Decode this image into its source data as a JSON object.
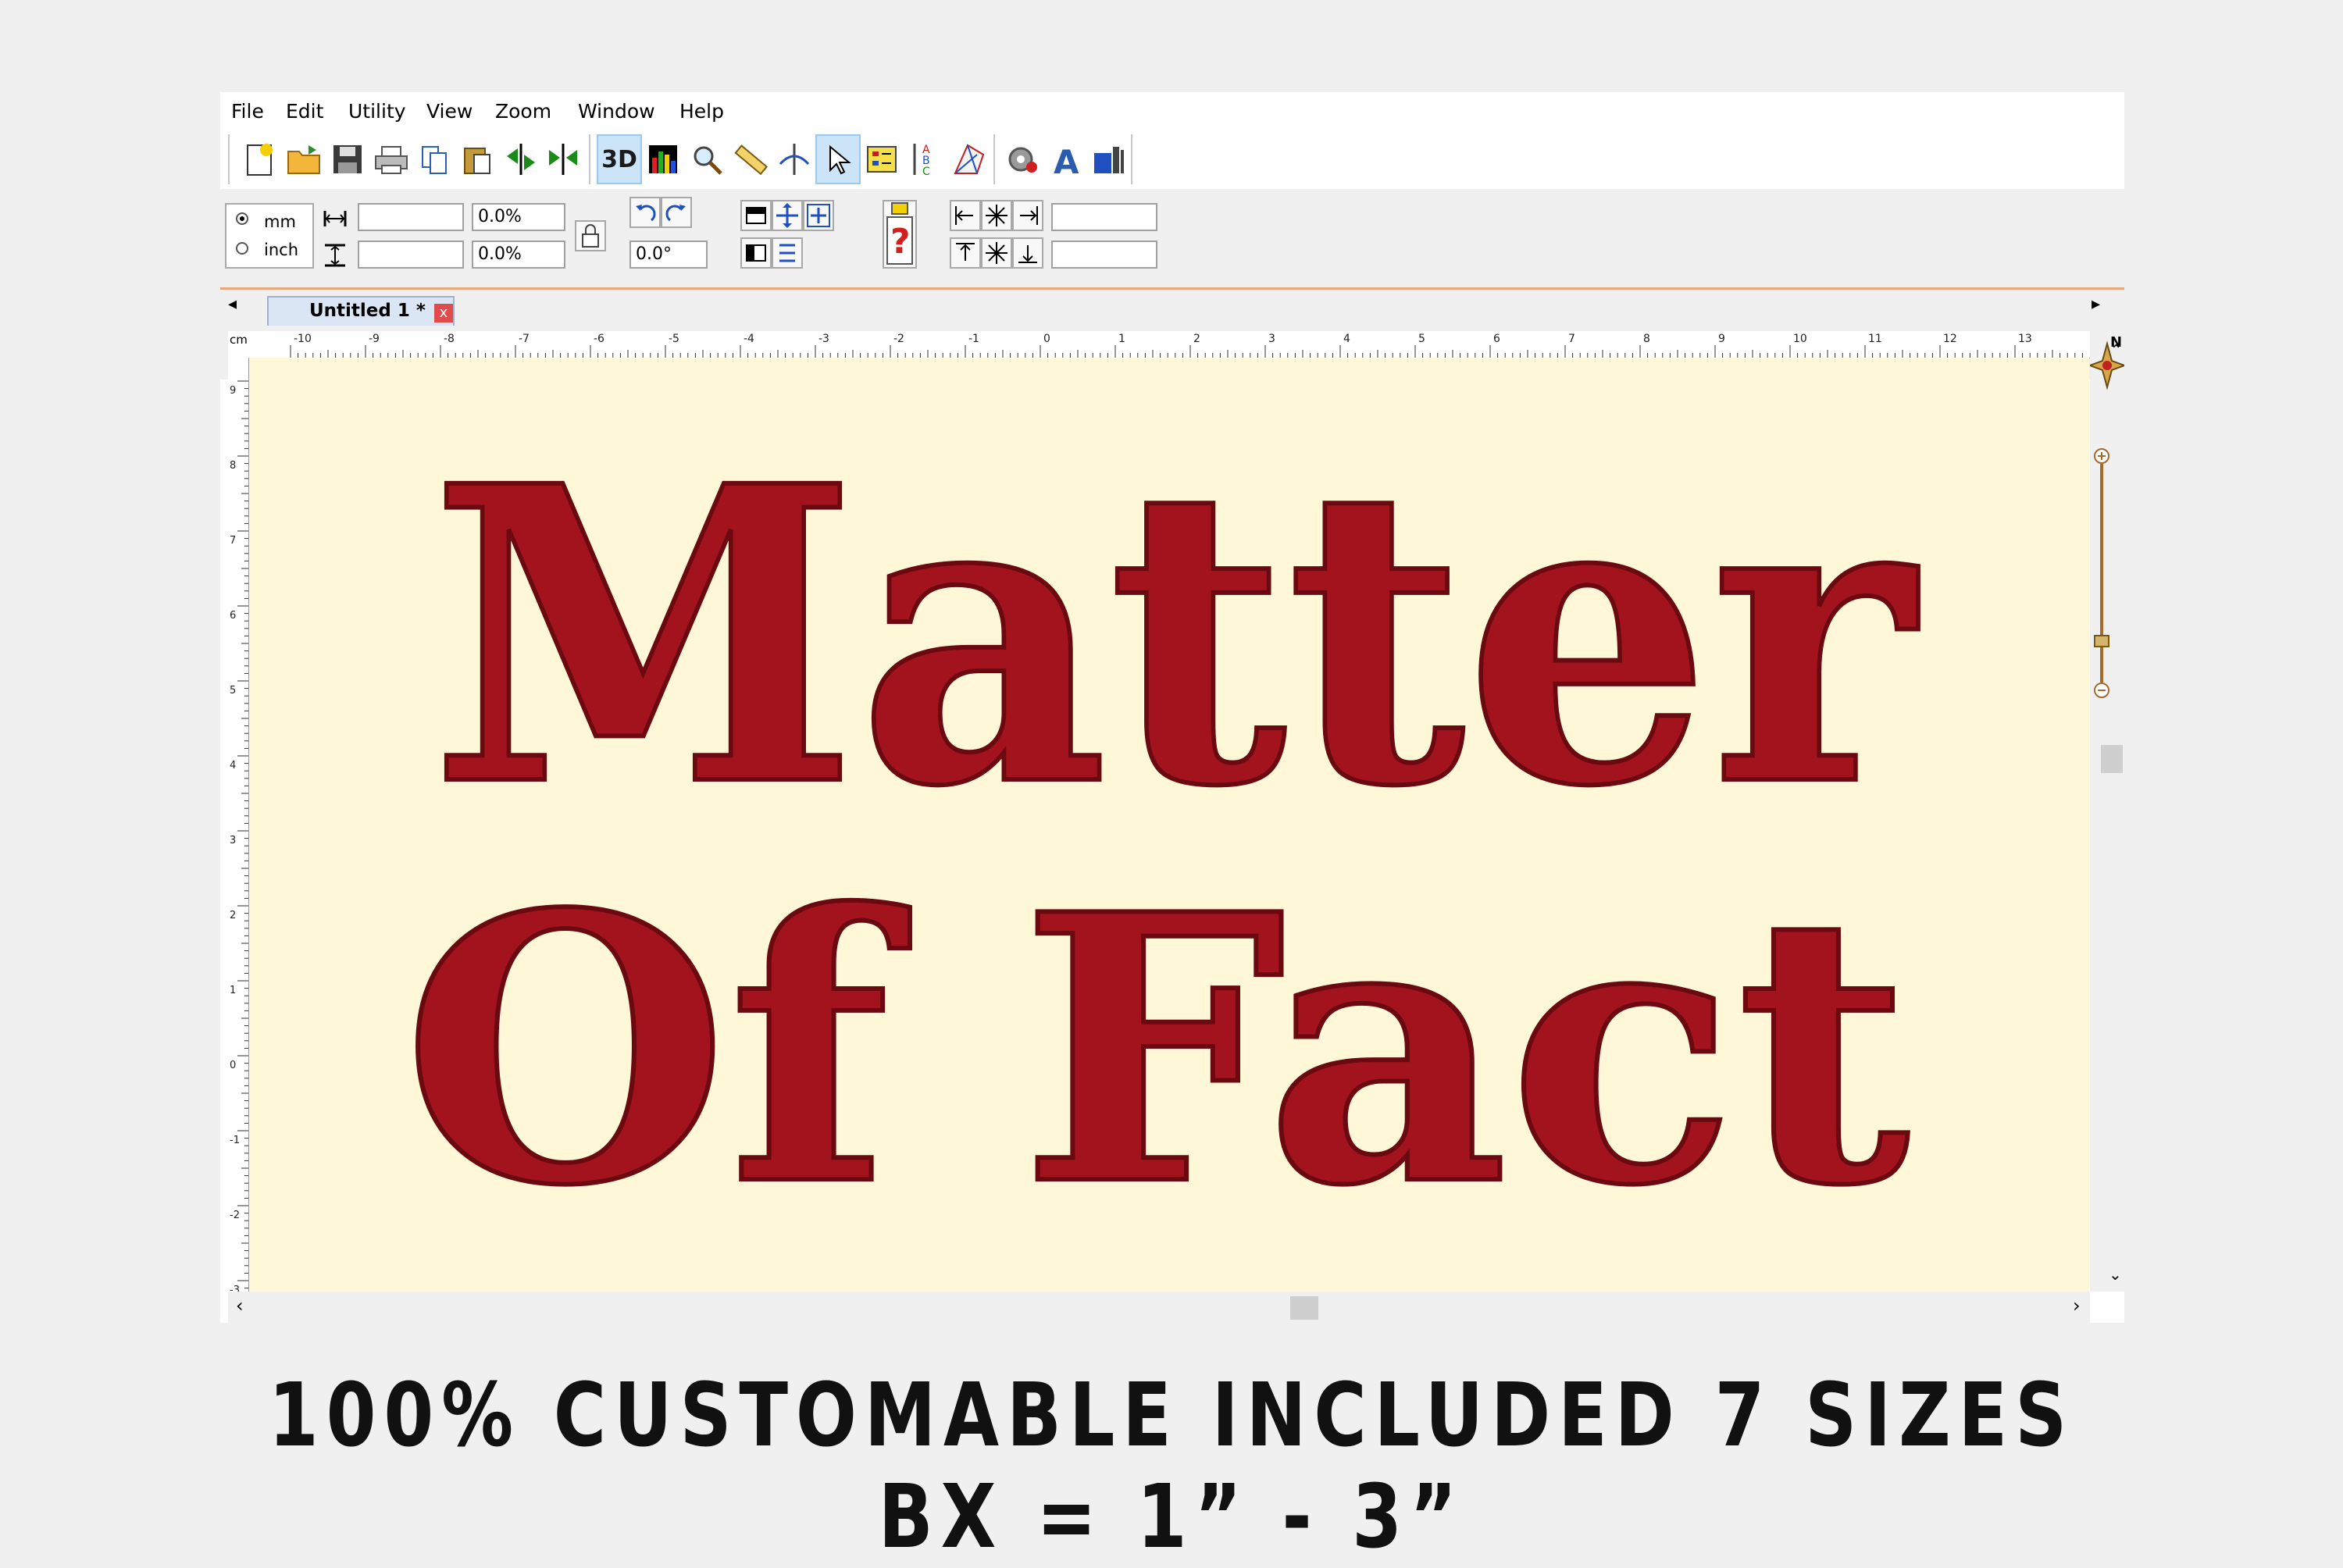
{
  "menu": {
    "items": [
      "File",
      "Edit",
      "Utility",
      "View",
      "Zoom",
      "Window",
      "Help"
    ]
  },
  "toolbar": {
    "btn_3d": "3D"
  },
  "units": {
    "mm": "mm",
    "inch": "inch",
    "selected": "mm"
  },
  "fields": {
    "width_value": "",
    "height_value": "",
    "scale_x": "0.0%",
    "scale_y": "0.0%",
    "rotation": "0.0°",
    "pos_x": "",
    "pos_y": ""
  },
  "tab": {
    "title": "Untitled 1 *",
    "close": "x"
  },
  "ruler": {
    "unit": "cm",
    "top_ticks": [
      "-10",
      "-9",
      "-8",
      "-7",
      "-6",
      "-5",
      "-4",
      "-3",
      "-2",
      "-1",
      "0",
      "1",
      "2",
      "3",
      "4",
      "5",
      "6",
      "7",
      "8",
      "9",
      "10",
      "11",
      "12",
      "13"
    ],
    "left_ticks": [
      "9",
      "8",
      "7",
      "6",
      "5",
      "4",
      "3",
      "2",
      "1",
      "0",
      "-1",
      "-2",
      "-3"
    ]
  },
  "compass": {
    "label": "N"
  },
  "design": {
    "line1": "Matter",
    "line2": "Of Fact",
    "color": "#a3131d"
  },
  "caption": {
    "text": "100% CUSTOMABLE INCLUDED 7 SIZES BX = 1” -  3”"
  }
}
